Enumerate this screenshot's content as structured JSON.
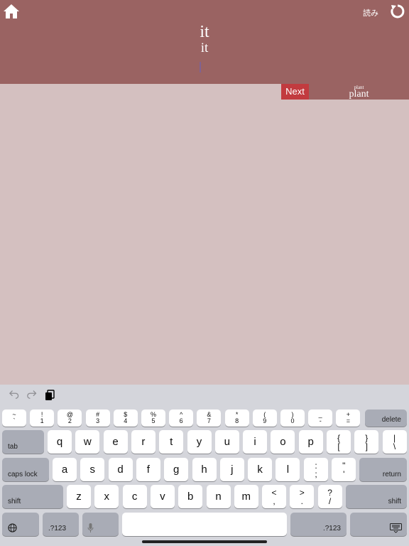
{
  "header": {
    "yomi_label": "読み",
    "word_primary": "it",
    "word_secondary": "it"
  },
  "next": {
    "label": "Next",
    "upcoming_small": "plant",
    "upcoming_large": "plant"
  },
  "keyboard": {
    "number_row": [
      {
        "top": "~",
        "bottom": "`"
      },
      {
        "top": "!",
        "bottom": "1"
      },
      {
        "top": "@",
        "bottom": "2"
      },
      {
        "top": "#",
        "bottom": "3"
      },
      {
        "top": "$",
        "bottom": "4"
      },
      {
        "top": "%",
        "bottom": "5"
      },
      {
        "top": "^",
        "bottom": "6"
      },
      {
        "top": "&",
        "bottom": "7"
      },
      {
        "top": "*",
        "bottom": "8"
      },
      {
        "top": "(",
        "bottom": "9"
      },
      {
        "top": ")",
        "bottom": "0"
      },
      {
        "top": "_",
        "bottom": "-"
      },
      {
        "top": "+",
        "bottom": "="
      }
    ],
    "delete_label": "delete",
    "tab_label": "tab",
    "row1": [
      "q",
      "w",
      "e",
      "r",
      "t",
      "y",
      "u",
      "i",
      "o",
      "p"
    ],
    "row1_extra": [
      {
        "top": "{",
        "bottom": "["
      },
      {
        "top": "}",
        "bottom": "]"
      },
      {
        "top": "|",
        "bottom": "\\"
      }
    ],
    "caps_label": "caps lock",
    "row2": [
      "a",
      "s",
      "d",
      "f",
      "g",
      "h",
      "j",
      "k",
      "l"
    ],
    "row2_extra": [
      {
        "top": ":",
        "bottom": ";"
      },
      {
        "top": "\"",
        "bottom": "'"
      }
    ],
    "return_label": "return",
    "shift_label": "shift",
    "row3": [
      "z",
      "x",
      "c",
      "v",
      "b",
      "n",
      "m"
    ],
    "row3_extra": [
      {
        "top": "<",
        "bottom": ","
      },
      {
        "top": ">",
        "bottom": "."
      },
      {
        "top": "?",
        "bottom": "/"
      }
    ],
    "numbers_label": ".?123",
    "icons": {
      "undo": "undo-icon",
      "redo": "redo-icon",
      "paste": "clipboard-icon",
      "globe": "globe-icon",
      "mic": "microphone-icon",
      "hide": "keyboard-hide-icon"
    }
  }
}
